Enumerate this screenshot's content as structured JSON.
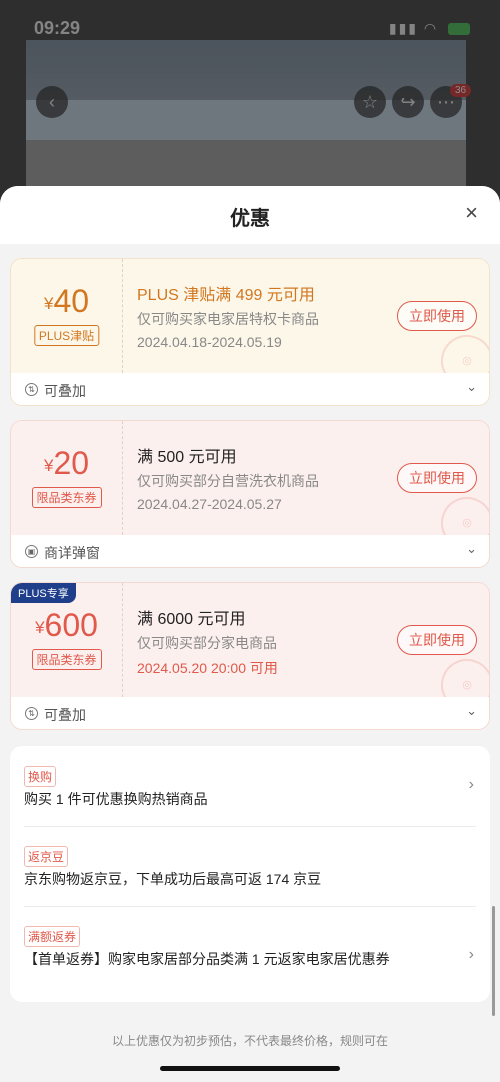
{
  "status": {
    "time": "09:29"
  },
  "background": {
    "badge_count": "36"
  },
  "sheet": {
    "title": "优惠",
    "close_glyph": "×"
  },
  "coupons": [
    {
      "yen": "¥",
      "amount": "40",
      "tag": "PLUS津贴",
      "title": "PLUS 津贴满 499 元可用",
      "desc": "仅可购买家电家居特权卡商品",
      "date": "2024.04.18-2024.05.19",
      "button": "立即使用",
      "footer": "可叠加",
      "colors": {
        "bg": "#fdf7ea",
        "amount": "#d2771f",
        "title": "#d2771f",
        "border": "#f1e3c9"
      }
    },
    {
      "yen": "¥",
      "amount": "20",
      "tag": "限品类东券",
      "title": "满 500 元可用",
      "desc": "仅可购买部分自营洗衣机商品",
      "date": "2024.04.27-2024.05.27",
      "button": "立即使用",
      "footer": "商详弹窗",
      "colors": {
        "bg": "#fcf0ee",
        "amount": "#e0594b",
        "title": "#222222",
        "border": "#f4d9d3"
      }
    },
    {
      "badge": "PLUS专享",
      "yen": "¥",
      "amount": "600",
      "tag": "限品类东券",
      "title": "满 6000 元可用",
      "desc": "仅可购买部分家电商品",
      "date": "2024.05.20 20:00 可用",
      "button": "立即使用",
      "footer": "可叠加",
      "colors": {
        "bg": "#fcf0ee",
        "amount": "#e0594b",
        "title": "#222222",
        "date": "#e0594b",
        "border": "#f4d9d3"
      }
    }
  ],
  "promotions": [
    {
      "tag": "换购",
      "text": "购买 1 件可优惠换购热销商品",
      "has_chevron": true
    },
    {
      "tag": "返京豆",
      "text": "京东购物返京豆，下单成功后最高可返 174 京豆",
      "has_chevron": false
    },
    {
      "tag": "满额返券",
      "text": "【首单返券】购家电家居部分品类满 1 元返家电家居优惠券",
      "has_chevron": true
    }
  ],
  "footnote": "以上优惠仅为初步预估，不代表最终价格，规则可在",
  "icons": {
    "chevron_right": "›",
    "chevron_down": "⌄"
  }
}
